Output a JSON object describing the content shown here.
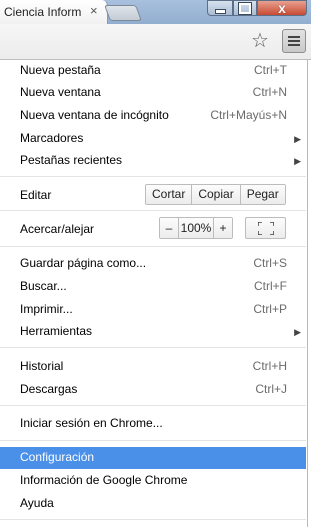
{
  "tab": {
    "title": "Ciencia Inform",
    "close": "×"
  },
  "window_buttons": {
    "close": "x"
  },
  "toolbar": {
    "star": "☆"
  },
  "menu": {
    "items": [
      {
        "label": "Nueva pestaña",
        "shortcut": "Ctrl+T"
      },
      {
        "label": "Nueva ventana",
        "shortcut": "Ctrl+N"
      },
      {
        "label": "Nueva ventana de incógnito",
        "shortcut": "Ctrl+Mayús+N"
      },
      {
        "label": "Marcadores",
        "arrow": "▶"
      },
      {
        "label": "Pestañas recientes",
        "arrow": "▶"
      },
      {
        "label": "Editar"
      },
      {
        "label": "Acercar/alejar"
      },
      {
        "label": "Guardar página como...",
        "shortcut": "Ctrl+S"
      },
      {
        "label": "Buscar...",
        "shortcut": "Ctrl+F"
      },
      {
        "label": "Imprimir...",
        "shortcut": "Ctrl+P"
      },
      {
        "label": "Herramientas",
        "arrow": "▶"
      },
      {
        "label": "Historial",
        "shortcut": "Ctrl+H"
      },
      {
        "label": "Descargas",
        "shortcut": "Ctrl+J"
      },
      {
        "label": "Iniciar sesión en Chrome..."
      },
      {
        "label": "Configuración",
        "selected": true
      },
      {
        "label": "Información de Google Chrome"
      },
      {
        "label": "Ayuda"
      }
    ],
    "edit": {
      "cut": "Cortar",
      "copy": "Copiar",
      "paste": "Pegar"
    },
    "zoom": {
      "minus": "–",
      "value": "100%",
      "plus": "+"
    }
  },
  "colors": {
    "selected_bg": "#4a8fe8",
    "tabstrip": "#9fb8d8",
    "close_button": "#c74a34"
  }
}
